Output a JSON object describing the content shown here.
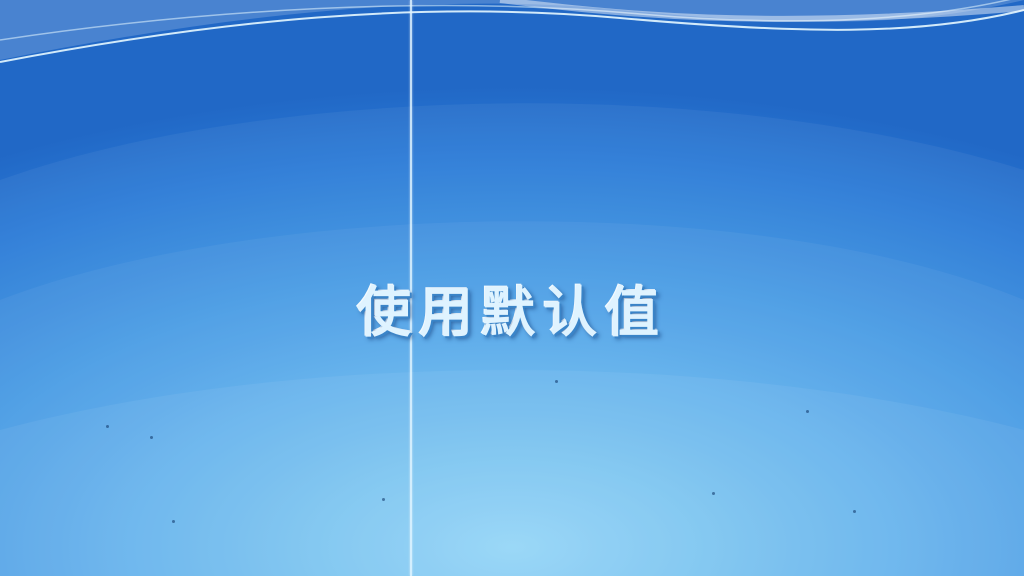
{
  "slide": {
    "title": "使用默认值"
  },
  "colors": {
    "background_top": "#2168c6",
    "background_bottom": "#8ad2f7",
    "title_text": "#dff3ff",
    "title_shadow": "#3a84c8"
  }
}
